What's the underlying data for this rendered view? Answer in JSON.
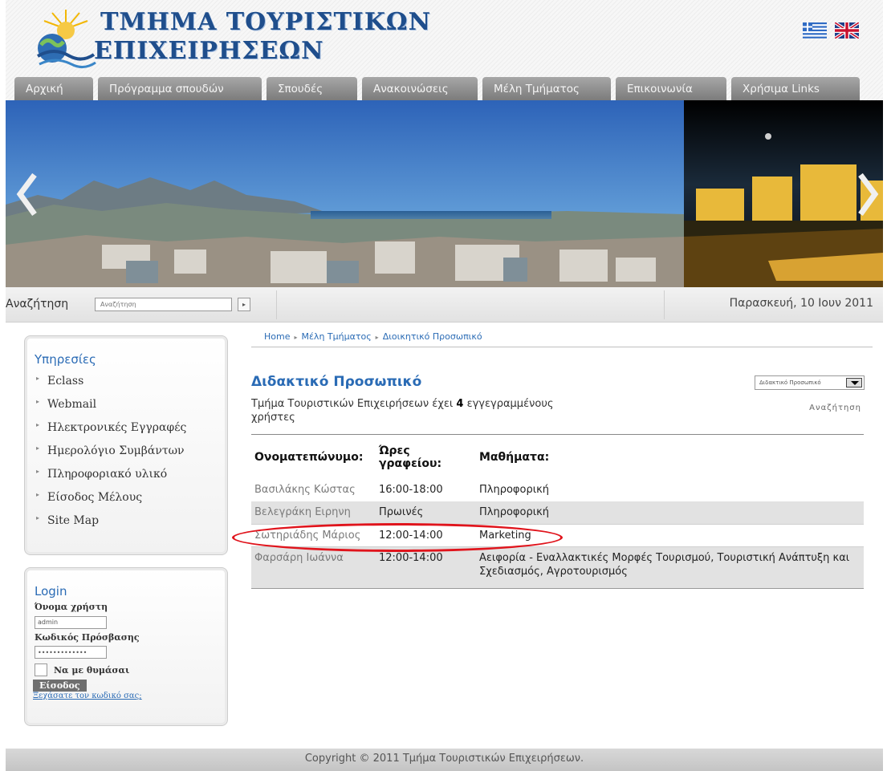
{
  "header": {
    "title_line1": "ΤΜΗΜΑ ΤΟΥΡΙΣΤΙΚΩΝ",
    "title_line2": "ΕΠΙΧΕΙΡΗΣΕΩΝ"
  },
  "nav": {
    "tabs": [
      {
        "label": "Αρχική"
      },
      {
        "label": "Πρόγραμμα σπουδών"
      },
      {
        "label": "Σπουδές"
      },
      {
        "label": "Ανακοινώσεις"
      },
      {
        "label": "Μέλη Τμήματος"
      },
      {
        "label": "Επικοινωνία"
      },
      {
        "label": "Χρήσιμα Links"
      }
    ]
  },
  "searchbar": {
    "label": "Αναζήτηση",
    "placeholder": "Αναζήτηση",
    "go_symbol": "▸",
    "date": "Παρασκευή, 10 Ιουν 2011"
  },
  "services": {
    "title": "Υπηρεσίες",
    "items": [
      {
        "label": "Eclass"
      },
      {
        "label": "Webmail"
      },
      {
        "label": "Ηλεκτρονικές Εγγραφές"
      },
      {
        "label": "Ημερολόγιο Συμβάντων"
      },
      {
        "label": "Πληροφοριακό υλικό"
      },
      {
        "label": "Είσοδος Μέλους"
      },
      {
        "label": "Site Map"
      }
    ]
  },
  "login": {
    "title": "Login",
    "username_label": "Όνομα χρήστη",
    "username_value": "admin",
    "password_label": "Κωδικός Πρόσβασης",
    "password_value": "•••••••••••••",
    "remember_label": "Να με θυμάσαι",
    "submit_label": "Είσοδος",
    "forgot_label": "Ξεχάσατε τον κωδικό σας;"
  },
  "breadcrumb": {
    "items": [
      "Home",
      "Μέλη Τμήματος",
      "Διοικητικό Προσωπικό"
    ],
    "separator": "▸"
  },
  "main": {
    "title": "Διδακτικό Προσωπικό",
    "subtitle_prefix": "Τμήμα Τουριστικών Επιχειρήσεων έχει ",
    "subtitle_count": "4",
    "subtitle_suffix": " εγγεγραμμένους χρήστες",
    "filter_value": "Διδακτικό Προσωπικό",
    "search_link": "Αναζήτηση"
  },
  "table": {
    "headers": [
      "Ονοματεπώνυμο:",
      "Ώρες γραφείου:",
      "Μαθήματα:"
    ],
    "rows": [
      {
        "name": "Βασιλάκης Κώστας",
        "hours": "16:00-18:00",
        "courses": "Πληροφορική"
      },
      {
        "name": "Βελεγράκη Ειρηνη",
        "hours": "Πρωινές",
        "courses": "Πληροφορική"
      },
      {
        "name": "Σωτηριάδης Μάριος",
        "hours": "12:00-14:00",
        "courses": "Marketing"
      },
      {
        "name": "Φαρσάρη Ιωάννα",
        "hours": "12:00-14:00",
        "courses": "Αειφορία - Εναλλακτικές Μορφές Τουρισμού, Τουριστική Ανάπτυξη και Σχεδιασμός, Αγροτουρισμός"
      }
    ]
  },
  "footer": {
    "copyright": "Copyright © 2011 Τμήμα Τουριστικών Επιχειρήσεων."
  },
  "colors": {
    "accent": "#2a6bb5",
    "nav_tab": "#8a8a8a",
    "highlight": "#e0141c"
  }
}
